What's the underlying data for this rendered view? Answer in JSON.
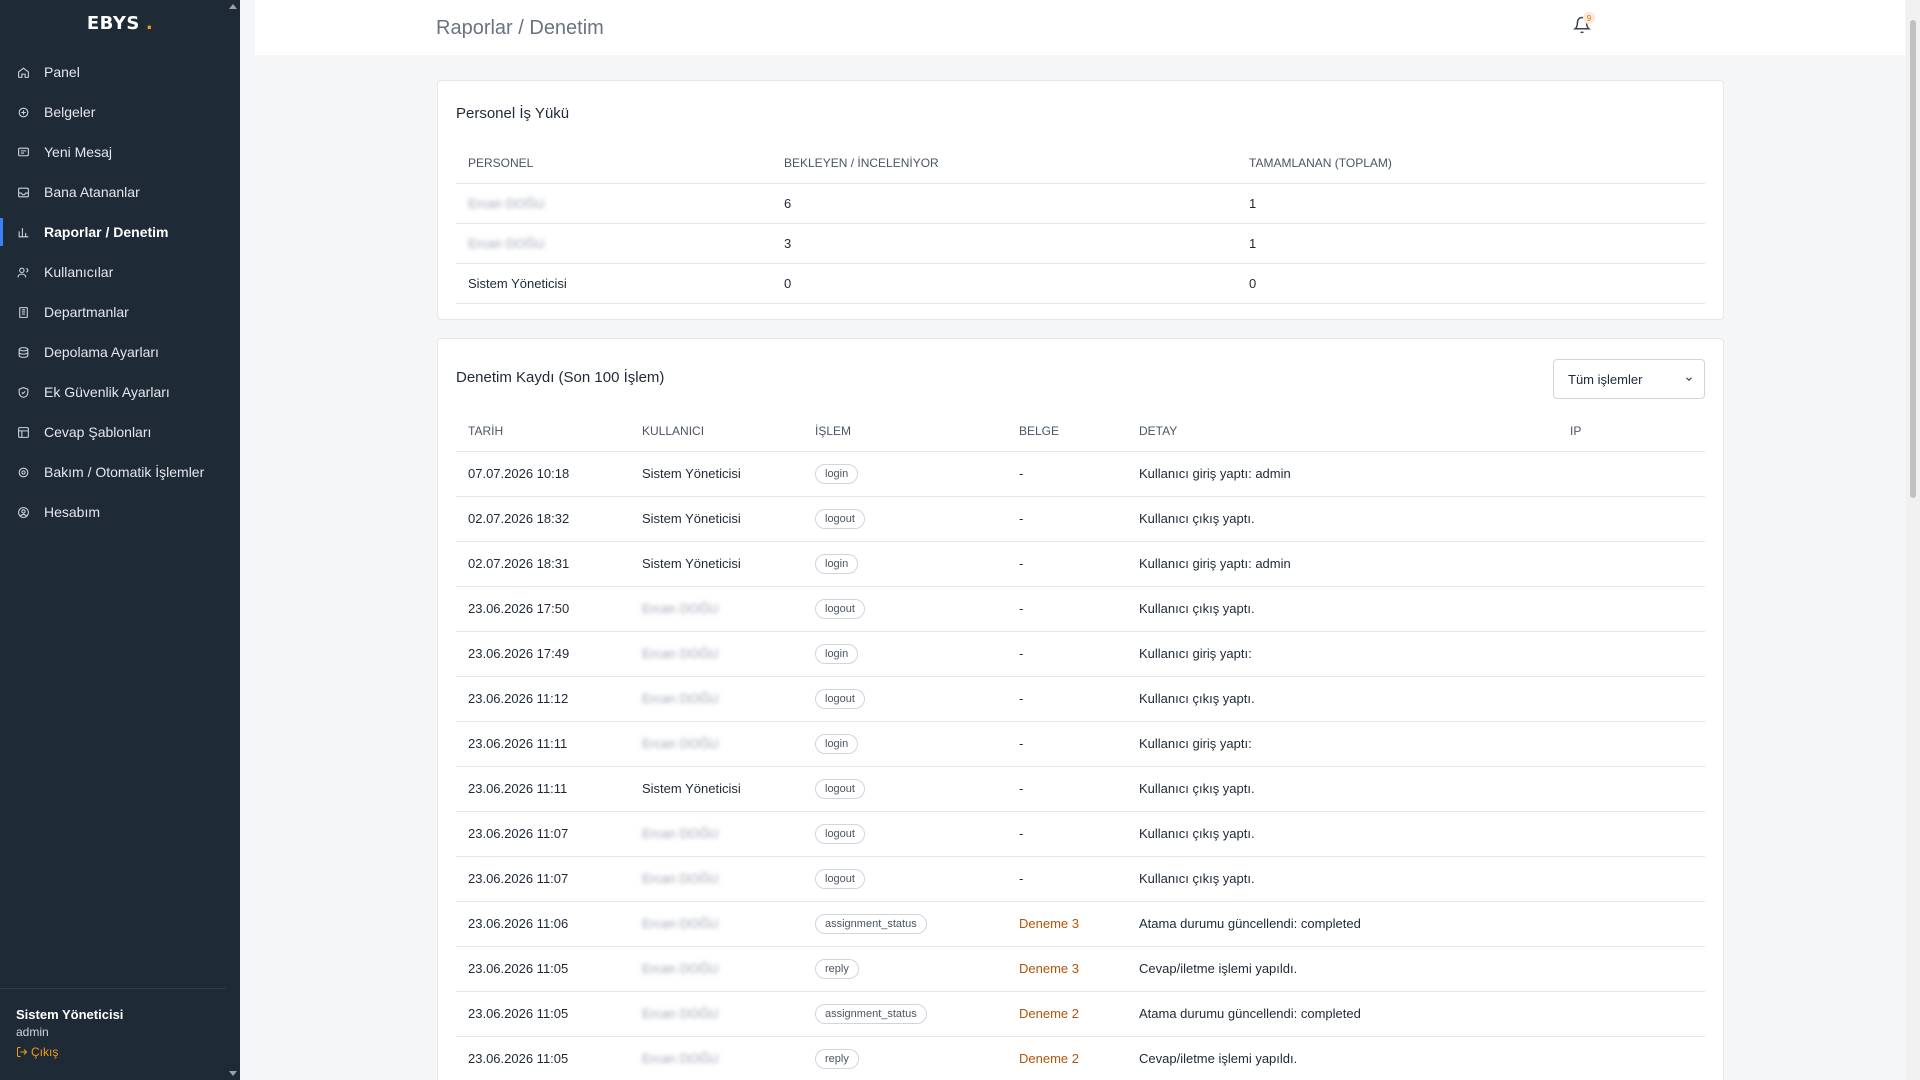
{
  "brand": {
    "name": "EBYS",
    "dot": "."
  },
  "sidebar": {
    "items": [
      {
        "label": "Panel",
        "icon": "home-icon"
      },
      {
        "label": "Belgeler",
        "icon": "documents-icon"
      },
      {
        "label": "Yeni Mesaj",
        "icon": "message-icon"
      },
      {
        "label": "Bana Atananlar",
        "icon": "inbox-icon"
      },
      {
        "label": "Raporlar / Denetim",
        "icon": "chart-icon",
        "active": true
      },
      {
        "label": "Kullanıcılar",
        "icon": "users-icon"
      },
      {
        "label": "Departmanlar",
        "icon": "building-icon"
      },
      {
        "label": "Depolama Ayarları",
        "icon": "database-icon"
      },
      {
        "label": "Ek Güvenlik Ayarları",
        "icon": "shield-icon"
      },
      {
        "label": "Cevap Şablonları",
        "icon": "template-icon"
      },
      {
        "label": "Bakım / Otomatik İşlemler",
        "icon": "gear-icon"
      },
      {
        "label": "Hesabım",
        "icon": "account-icon"
      }
    ],
    "footer": {
      "user": "Sistem Yöneticisi",
      "role": "admin",
      "logout": "Çıkış"
    }
  },
  "header": {
    "title": "Raporlar / Denetim",
    "notification_count": "9"
  },
  "workload": {
    "title": "Personel İş Yükü",
    "columns": [
      "PERSONEL",
      "BEKLEYEN / İNCELENİYOR",
      "TAMAMLANAN (TOPLAM)"
    ],
    "rows": [
      {
        "name": "Ercan DOĞU",
        "pending": "6",
        "done": "1",
        "blurred": true
      },
      {
        "name": "Ercan DOĞU",
        "pending": "3",
        "done": "1",
        "blurred": true
      },
      {
        "name": "Sistem Yöneticisi",
        "pending": "0",
        "done": "0",
        "blurred": false
      }
    ]
  },
  "audit": {
    "title": "Denetim Kaydı (Son 100 İşlem)",
    "filter": "Tüm işlemler",
    "columns": [
      "TARİH",
      "KULLANICI",
      "İŞLEM",
      "BELGE",
      "DETAY",
      "IP"
    ],
    "rows": [
      {
        "date": "07.07.2026 10:18",
        "user": "Sistem Yöneticisi",
        "blurred": false,
        "action": "login",
        "doc": "-",
        "detail": "Kullanıcı giriş yaptı: admin",
        "ip": ""
      },
      {
        "date": "02.07.2026 18:32",
        "user": "Sistem Yöneticisi",
        "blurred": false,
        "action": "logout",
        "doc": "-",
        "detail": "Kullanıcı çıkış yaptı.",
        "ip": ""
      },
      {
        "date": "02.07.2026 18:31",
        "user": "Sistem Yöneticisi",
        "blurred": false,
        "action": "login",
        "doc": "-",
        "detail": "Kullanıcı giriş yaptı: admin",
        "ip": ""
      },
      {
        "date": "23.06.2026 17:50",
        "user": "Ercan DOĞU",
        "blurred": true,
        "action": "logout",
        "doc": "-",
        "detail": "Kullanıcı çıkış yaptı.",
        "ip": ""
      },
      {
        "date": "23.06.2026 17:49",
        "user": "Ercan DOĞU",
        "blurred": true,
        "action": "login",
        "doc": "-",
        "detail": "Kullanıcı giriş yaptı:",
        "ip": ""
      },
      {
        "date": "23.06.2026 11:12",
        "user": "Ercan DOĞU",
        "blurred": true,
        "action": "logout",
        "doc": "-",
        "detail": "Kullanıcı çıkış yaptı.",
        "ip": ""
      },
      {
        "date": "23.06.2026 11:11",
        "user": "Ercan DOĞU",
        "blurred": true,
        "action": "login",
        "doc": "-",
        "detail": "Kullanıcı giriş yaptı:",
        "ip": ""
      },
      {
        "date": "23.06.2026 11:11",
        "user": "Sistem Yöneticisi",
        "blurred": false,
        "action": "logout",
        "doc": "-",
        "detail": "Kullanıcı çıkış yaptı.",
        "ip": ""
      },
      {
        "date": "23.06.2026 11:07",
        "user": "Ercan DOĞU",
        "blurred": true,
        "action": "logout",
        "doc": "-",
        "detail": "Kullanıcı çıkış yaptı.",
        "ip": ""
      },
      {
        "date": "23.06.2026 11:07",
        "user": "Ercan DOĞU",
        "blurred": true,
        "action": "logout",
        "doc": "-",
        "detail": "Kullanıcı çıkış yaptı.",
        "ip": ""
      },
      {
        "date": "23.06.2026 11:06",
        "user": "Ercan DOĞU",
        "blurred": true,
        "action": "assignment_status",
        "doc": "Deneme 3",
        "detail": "Atama durumu güncellendi: completed",
        "ip": ""
      },
      {
        "date": "23.06.2026 11:05",
        "user": "Ercan DOĞU",
        "blurred": true,
        "action": "reply",
        "doc": "Deneme 3",
        "detail": "Cevap/iletme işlemi yapıldı.",
        "ip": ""
      },
      {
        "date": "23.06.2026 11:05",
        "user": "Ercan DOĞU",
        "blurred": true,
        "action": "assignment_status",
        "doc": "Deneme 2",
        "detail": "Atama durumu güncellendi: completed",
        "ip": ""
      },
      {
        "date": "23.06.2026 11:05",
        "user": "Ercan DOĞU",
        "blurred": true,
        "action": "reply",
        "doc": "Deneme 2",
        "detail": "Cevap/iletme işlemi yapıldı.",
        "ip": ""
      }
    ]
  },
  "colors": {
    "sidebar_bg": "#1f2a37",
    "accent": "#f59e0b",
    "link": "#b45309"
  }
}
